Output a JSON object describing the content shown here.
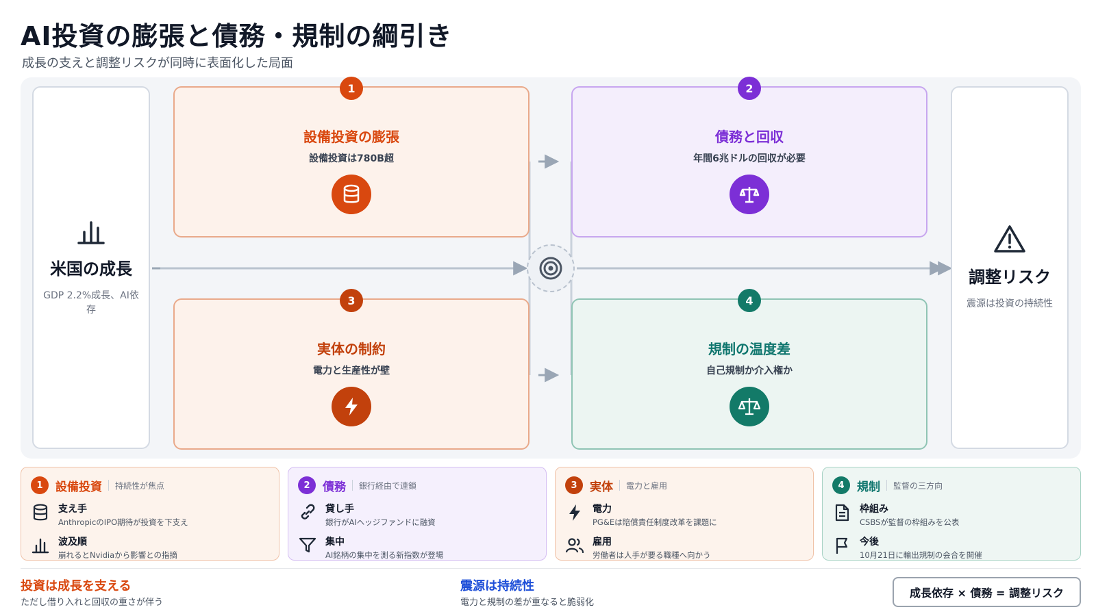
{
  "title": "AI投資の膨張と債務・規制の綱引き",
  "subtitle": "成長の支えと調整リスクが同時に表面化した局面",
  "left_card": {
    "title": "米国の成長",
    "sub": "GDP 2.2%成長、AI依存",
    "icon": "bar-chart-icon"
  },
  "right_card": {
    "title": "調整リスク",
    "sub": "震源は投資の持続性",
    "icon": "warning-icon"
  },
  "stages": [
    {
      "num": "1",
      "title": "設備投資の膨張",
      "sub": "設備投資は780B超",
      "icon": "database-icon",
      "color": "#d9480f"
    },
    {
      "num": "2",
      "title": "債務と回収",
      "sub": "年間6兆ドルの回収が必要",
      "icon": "scale-icon",
      "color": "#7c2fd6"
    },
    {
      "num": "3",
      "title": "実体の制約",
      "sub": "電力と生産性が壁",
      "icon": "lightning-icon",
      "color": "#c2410c"
    },
    {
      "num": "4",
      "title": "規制の温度差",
      "sub": "自己規制か介入権か",
      "icon": "balance-icon",
      "color": "#137a68"
    }
  ],
  "hub_icon": "target-icon",
  "panels": [
    {
      "num": "1",
      "name": "設備投資",
      "note": "持続性が焦点",
      "items": [
        {
          "title": "支え手",
          "desc": "AnthropicのIPO期待が投資を下支え",
          "icon": "database-icon"
        },
        {
          "title": "波及順",
          "desc": "崩れるとNvidiaから影響との指摘",
          "icon": "bar-chart-icon"
        }
      ]
    },
    {
      "num": "2",
      "name": "債務",
      "note": "銀行経由で連鎖",
      "items": [
        {
          "title": "貸し手",
          "desc": "銀行がAIヘッジファンドに融資",
          "icon": "link-icon"
        },
        {
          "title": "集中",
          "desc": "AI銘柄の集中を測る新指数が登場",
          "icon": "filter-icon"
        }
      ]
    },
    {
      "num": "3",
      "name": "実体",
      "note": "電力と雇用",
      "items": [
        {
          "title": "電力",
          "desc": "PG&Eは賠償責任制度改革を課題に",
          "icon": "lightning-icon"
        },
        {
          "title": "雇用",
          "desc": "労働者は人手が要る職種へ向かう",
          "icon": "people-icon"
        }
      ]
    },
    {
      "num": "4",
      "name": "規制",
      "note": "監督の三方向",
      "items": [
        {
          "title": "枠組み",
          "desc": "CSBSが監督の枠組みを公表",
          "icon": "document-icon"
        },
        {
          "title": "今後",
          "desc": "10月21日に輸出規制の会合を開催",
          "icon": "flag-icon"
        }
      ]
    }
  ],
  "footer": {
    "left_title": "投資は成長を支える",
    "left_sub": "ただし借り入れと回収の重さが伴う",
    "mid_title": "震源は持続性",
    "mid_sub": "電力と規制の差が重なると脆弱化",
    "formula": "成長依存 × 債務 = 調整リスク"
  },
  "colors": {
    "orange": "#d9480f",
    "purple": "#7c2fd6",
    "red": "#c2410c",
    "teal": "#137a68",
    "blue": "#1d4ed8"
  }
}
